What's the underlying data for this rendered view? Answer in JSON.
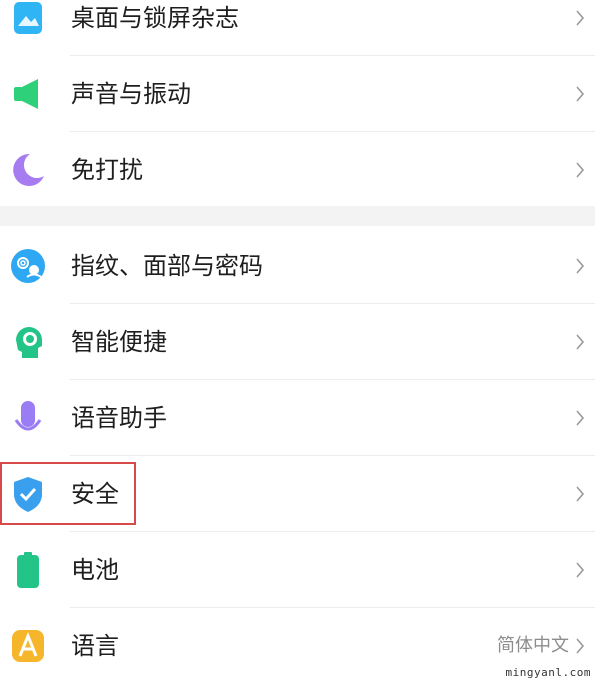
{
  "settings": {
    "items": [
      {
        "key": "wallpaper",
        "label": "桌面与锁屏杂志",
        "value": "",
        "icon": "wallpaper-icon"
      },
      {
        "key": "sound",
        "label": "声音与振动",
        "value": "",
        "icon": "speaker-icon"
      },
      {
        "key": "dnd",
        "label": "免打扰",
        "value": "",
        "icon": "moon-icon"
      },
      {
        "key": "biometrics",
        "label": "指纹、面部与密码",
        "value": "",
        "icon": "fingerprint-face-icon"
      },
      {
        "key": "smart",
        "label": "智能便捷",
        "value": "",
        "icon": "smart-head-icon"
      },
      {
        "key": "voice",
        "label": "语音助手",
        "value": "",
        "icon": "microphone-icon"
      },
      {
        "key": "security",
        "label": "安全",
        "value": "",
        "icon": "shield-check-icon"
      },
      {
        "key": "battery",
        "label": "电池",
        "value": "",
        "icon": "battery-icon"
      },
      {
        "key": "language",
        "label": "语言",
        "value": "简体中文",
        "icon": "language-a-icon"
      }
    ],
    "chevron": "chevron-right-icon",
    "highlighted_item": "security"
  },
  "watermark": "mingyanl.com",
  "colors": {
    "highlight_border": "#d84a4a",
    "text_primary": "#1e1e1e",
    "text_secondary": "#8c8c8c",
    "section_gap": "#f3f3f3"
  }
}
